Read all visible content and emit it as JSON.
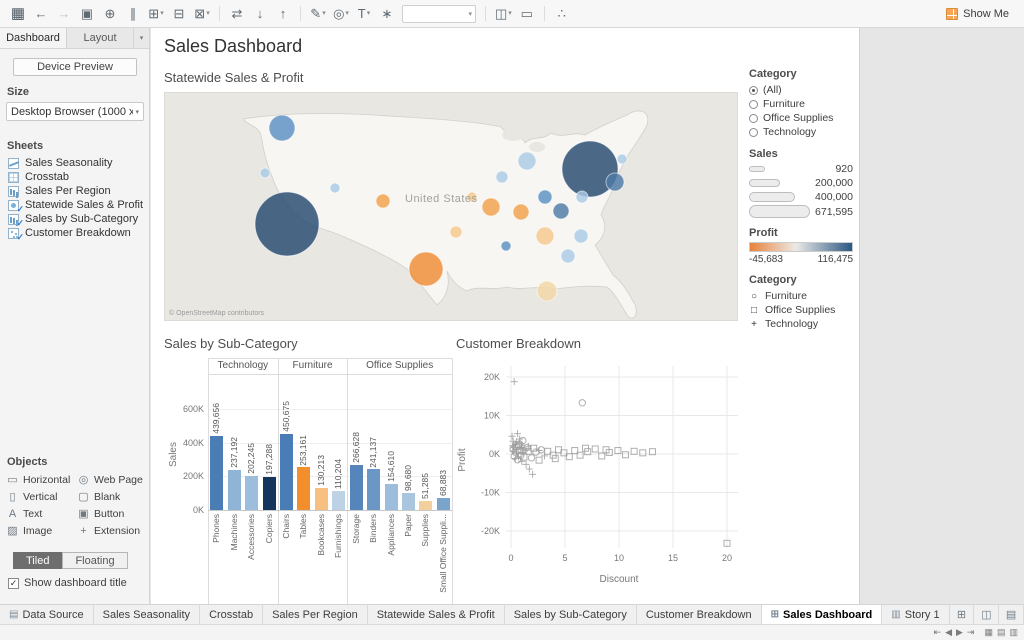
{
  "toolbar": {
    "show_me": "Show Me",
    "items": [
      {
        "name": "tableau-logo-button",
        "glyph": "▦",
        "logo": true
      },
      {
        "name": "undo-button",
        "glyph": "←"
      },
      {
        "name": "redo-button",
        "glyph": "→",
        "disabled": true
      },
      {
        "name": "save-button",
        "glyph": "▣"
      },
      {
        "name": "add-data-button",
        "glyph": "⊕"
      },
      {
        "name": "pause-updates-button",
        "glyph": "∥"
      },
      {
        "name": "new-worksheet-button",
        "glyph": "⊞",
        "caret": true
      },
      {
        "name": "duplicate-button",
        "glyph": "⊟"
      },
      {
        "name": "clear-sheet-button",
        "glyph": "⊠",
        "caret": true
      },
      {
        "sep": true
      },
      {
        "name": "swap-axes-button",
        "glyph": "⇄"
      },
      {
        "name": "sort-ascending-button",
        "glyph": "↓"
      },
      {
        "name": "sort-descending-button",
        "glyph": "↑"
      },
      {
        "sep": true
      },
      {
        "name": "highlight-button",
        "glyph": "✎",
        "caret": true
      },
      {
        "name": "group-members-button",
        "glyph": "◎",
        "caret": true
      },
      {
        "name": "show-mark-labels-button",
        "glyph": "T",
        "caret": true
      },
      {
        "name": "format-button",
        "glyph": "∗"
      },
      {
        "name": "fit-dropdown",
        "select": true,
        "value": ""
      },
      {
        "sep": true
      },
      {
        "name": "show-cards-button",
        "glyph": "◫",
        "caret": true
      },
      {
        "name": "presentation-mode-button",
        "glyph": "▭"
      },
      {
        "sep": true
      },
      {
        "name": "share-button",
        "glyph": "∴"
      }
    ]
  },
  "left_panel": {
    "tabs": [
      {
        "label": "Dashboard",
        "active": true
      },
      {
        "label": "Layout",
        "active": false
      }
    ],
    "device_preview": "Device Preview",
    "size_label": "Size",
    "size_value": "Desktop Browser (1000 x 8...",
    "sheets_label": "Sheets",
    "sheets": [
      {
        "label": "Sales Seasonality",
        "icon": "line-chart",
        "in_dashboard": false
      },
      {
        "label": "Crosstab",
        "icon": "crosstab",
        "in_dashboard": false
      },
      {
        "label": "Sales Per Region",
        "icon": "bar-chart",
        "in_dashboard": false
      },
      {
        "label": "Statewide Sales & Profit",
        "icon": "map",
        "in_dashboard": true
      },
      {
        "label": "Sales by Sub-Category",
        "icon": "bar-chart",
        "in_dashboard": true
      },
      {
        "label": "Customer Breakdown",
        "icon": "scatter",
        "in_dashboard": true
      }
    ],
    "objects_label": "Objects",
    "objects": [
      {
        "label": "Horizontal",
        "icon": "horizontal"
      },
      {
        "label": "Web Page",
        "icon": "web-page"
      },
      {
        "label": "Vertical",
        "icon": "vertical"
      },
      {
        "label": "Blank",
        "icon": "blank"
      },
      {
        "label": "Text",
        "icon": "text"
      },
      {
        "label": "Button",
        "icon": "button"
      },
      {
        "label": "Image",
        "icon": "image"
      },
      {
        "label": "Extension",
        "icon": "extension"
      }
    ],
    "tiled_label": "Tiled",
    "floating_label": "Floating",
    "show_dashboard_title": "Show dashboard title",
    "show_dashboard_title_checked": true
  },
  "dashboard": {
    "title": "Sales Dashboard",
    "map": {
      "title": "Statewide Sales & Profit",
      "country_label": "United States",
      "attribution": "© OpenStreetMap contributors"
    },
    "legends": {
      "category_filter": {
        "title": "Category",
        "options": [
          "(All)",
          "Furniture",
          "Office Supplies",
          "Technology"
        ],
        "selected": "(All)"
      },
      "sales_size": {
        "title": "Sales",
        "values": [
          "920",
          "200,000",
          "400,000",
          "671,595"
        ]
      },
      "profit_gradient": {
        "title": "Profit",
        "min_label": "-45,683",
        "max_label": "116,475",
        "min_color": "#e8823c",
        "mid_color": "#eceae6",
        "max_color": "#2a5783"
      },
      "category_shapes": {
        "title": "Category",
        "items": [
          {
            "shape": "circle",
            "label": "Furniture"
          },
          {
            "shape": "square",
            "label": "Office Supplies"
          },
          {
            "shape": "plus",
            "label": "Technology"
          }
        ]
      }
    },
    "bar_title": "Sales by Sub-Category",
    "scatter_title": "Customer Breakdown"
  },
  "chart_data": [
    {
      "type": "bar",
      "title": "Sales by Sub-Category",
      "ylabel": "Sales",
      "ymax": 600000,
      "yticks": [
        {
          "label": "0K",
          "value": 0
        },
        {
          "label": "200K",
          "value": 200000
        },
        {
          "label": "400K",
          "value": 400000
        },
        {
          "label": "600K",
          "value": 600000
        }
      ],
      "groups": [
        {
          "label": "Technology",
          "bars": [
            {
              "label": "Phones",
              "value": 439656,
              "value_label": "439,656",
              "color": "#4a7db5"
            },
            {
              "label": "Machines",
              "value": 237192,
              "value_label": "237,192",
              "color": "#8fb4d6"
            },
            {
              "label": "Accessories",
              "value": 202245,
              "value_label": "202,245",
              "color": "#9cbddb"
            },
            {
              "label": "Copiers",
              "value": 197288,
              "value_label": "197,288",
              "color": "#16355c"
            }
          ]
        },
        {
          "label": "Furniture",
          "bars": [
            {
              "label": "Chairs",
              "value": 450675,
              "value_label": "450,675",
              "color": "#4a7db5"
            },
            {
              "label": "Tables",
              "value": 253161,
              "value_label": "253,161",
              "color": "#f28e2b"
            },
            {
              "label": "Bookcases",
              "value": 130213,
              "value_label": "130,213",
              "color": "#f8c080"
            },
            {
              "label": "Furnishings",
              "value": 110204,
              "value_label": "110,204",
              "color": "#bed2e6"
            }
          ]
        },
        {
          "label": "Office Supplies",
          "bars": [
            {
              "label": "Storage",
              "value": 266628,
              "value_label": "266,628",
              "color": "#5585ba"
            },
            {
              "label": "Binders",
              "value": 241137,
              "value_label": "241,137",
              "color": "#6b97c6"
            },
            {
              "label": "Appliances",
              "value": 154610,
              "value_label": "154,610",
              "color": "#9cbddb"
            },
            {
              "label": "Paper",
              "value": 98680,
              "value_label": "98,680",
              "color": "#aac6de"
            },
            {
              "label": "Supplies",
              "value": 51285,
              "value_label": "51,285",
              "color": "#f4cf9e"
            },
            {
              "label": "Small Office Suppli...",
              "value": 68883,
              "value_label": "68,883",
              "color": "#7aa4cc"
            }
          ]
        }
      ]
    },
    {
      "type": "scatter",
      "title": "Customer Breakdown",
      "xlabel": "Discount",
      "ylabel": "Profit",
      "xticks": [
        0,
        5,
        10,
        15,
        20
      ],
      "yticks": [
        {
          "label": "20K",
          "value": 20000
        },
        {
          "label": "10K",
          "value": 10000
        },
        {
          "label": "0K",
          "value": 0
        },
        {
          "label": "-10K",
          "value": -10000
        },
        {
          "label": "-20K",
          "value": -20000
        }
      ],
      "xlim": [
        0,
        20
      ],
      "ylim": [
        -25000,
        21000
      ],
      "points": [
        {
          "shape": "plus",
          "x": 0.3,
          "y": 18800
        },
        {
          "shape": "plus",
          "x": 0.1,
          "y": 4600
        },
        {
          "shape": "plus",
          "x": 0.2,
          "y": 3300
        },
        {
          "shape": "plus",
          "x": 0.4,
          "y": 2500
        },
        {
          "shape": "plus",
          "x": 0.6,
          "y": 5300
        },
        {
          "shape": "plus",
          "x": 0.8,
          "y": 3900
        },
        {
          "shape": "plus",
          "x": 1.0,
          "y": 2300
        },
        {
          "shape": "plus",
          "x": 1.2,
          "y": 1100
        },
        {
          "shape": "plus",
          "x": 0.5,
          "y": 500
        },
        {
          "shape": "plus",
          "x": 0.7,
          "y": -700
        },
        {
          "shape": "plus",
          "x": 1.0,
          "y": -1900
        },
        {
          "shape": "plus",
          "x": 1.4,
          "y": -2700
        },
        {
          "shape": "plus",
          "x": 1.7,
          "y": -3900
        },
        {
          "shape": "plus",
          "x": 2.0,
          "y": -5300
        },
        {
          "shape": "plus",
          "x": 0.3,
          "y": 1700
        },
        {
          "shape": "plus",
          "x": 0.2,
          "y": 700
        },
        {
          "shape": "plus",
          "x": 0.9,
          "y": 1500
        },
        {
          "shape": "plus",
          "x": 1.1,
          "y": 300
        },
        {
          "shape": "plus",
          "x": 2.6,
          "y": 900
        },
        {
          "shape": "plus",
          "x": 3.1,
          "y": -500
        },
        {
          "shape": "plus",
          "x": 0.15,
          "y": 2100
        },
        {
          "shape": "plus",
          "x": 0.5,
          "y": 3100
        },
        {
          "shape": "plus",
          "x": 1.6,
          "y": 2000
        },
        {
          "shape": "plus",
          "x": 0.4,
          "y": -1200
        },
        {
          "shape": "circle",
          "x": 6.6,
          "y": 13300
        },
        {
          "shape": "circle",
          "x": 0.2,
          "y": 1300
        },
        {
          "shape": "circle",
          "x": 0.4,
          "y": 500
        },
        {
          "shape": "circle",
          "x": 0.7,
          "y": 2100
        },
        {
          "shape": "circle",
          "x": 0.9,
          "y": -400
        },
        {
          "shape": "circle",
          "x": 1.2,
          "y": 900
        },
        {
          "shape": "circle",
          "x": 1.5,
          "y": 1700
        },
        {
          "shape": "circle",
          "x": 1.9,
          "y": -1000
        },
        {
          "shape": "circle",
          "x": 2.3,
          "y": 500
        },
        {
          "shape": "circle",
          "x": 0.6,
          "y": -1500
        },
        {
          "shape": "circle",
          "x": 1.1,
          "y": 3500
        },
        {
          "shape": "circle",
          "x": 0.3,
          "y": -600
        },
        {
          "shape": "circle",
          "x": 2.8,
          "y": 1100
        },
        {
          "shape": "circle",
          "x": 0.8,
          "y": 2600
        },
        {
          "shape": "square",
          "x": 20,
          "y": -23200
        },
        {
          "shape": "square",
          "x": 3.4,
          "y": 700
        },
        {
          "shape": "square",
          "x": 3.9,
          "y": -300
        },
        {
          "shape": "square",
          "x": 4.4,
          "y": 1100
        },
        {
          "shape": "square",
          "x": 4.9,
          "y": 300
        },
        {
          "shape": "square",
          "x": 5.4,
          "y": -700
        },
        {
          "shape": "square",
          "x": 5.9,
          "y": 900
        },
        {
          "shape": "square",
          "x": 6.4,
          "y": -300
        },
        {
          "shape": "square",
          "x": 7.1,
          "y": 600
        },
        {
          "shape": "square",
          "x": 7.8,
          "y": 1300
        },
        {
          "shape": "square",
          "x": 8.4,
          "y": -500
        },
        {
          "shape": "square",
          "x": 9.1,
          "y": 400
        },
        {
          "shape": "square",
          "x": 9.9,
          "y": 900
        },
        {
          "shape": "square",
          "x": 10.6,
          "y": -200
        },
        {
          "shape": "square",
          "x": 11.4,
          "y": 700
        },
        {
          "shape": "square",
          "x": 12.2,
          "y": 300
        },
        {
          "shape": "square",
          "x": 13.1,
          "y": 600
        },
        {
          "shape": "square",
          "x": 2.1,
          "y": 1500
        },
        {
          "shape": "square",
          "x": 1.6,
          "y": 700
        },
        {
          "shape": "square",
          "x": 1.2,
          "y": -800
        },
        {
          "shape": "square",
          "x": 0.8,
          "y": 900
        },
        {
          "shape": "square",
          "x": 0.5,
          "y": 1900
        },
        {
          "shape": "square",
          "x": 4.1,
          "y": -1200
        },
        {
          "shape": "square",
          "x": 6.9,
          "y": 1500
        },
        {
          "shape": "square",
          "x": 8.8,
          "y": 1100
        },
        {
          "shape": "square",
          "x": 2.6,
          "y": -1600
        }
      ]
    },
    {
      "type": "map-bubbles",
      "title": "Statewide Sales & Profit",
      "bubbles": [
        {
          "x": 117,
          "y": 35,
          "r": 13,
          "color": "#5a8fc2"
        },
        {
          "x": 100,
          "y": 80,
          "r": 5,
          "color": "#a9c9e4"
        },
        {
          "x": 122,
          "y": 131,
          "r": 32,
          "color": "#24486f"
        },
        {
          "x": 170,
          "y": 95,
          "r": 5,
          "color": "#a9c9e4"
        },
        {
          "x": 218,
          "y": 108,
          "r": 7,
          "color": "#f0a04b"
        },
        {
          "x": 261,
          "y": 176,
          "r": 17,
          "color": "#ef8b33"
        },
        {
          "x": 425,
          "y": 76,
          "r": 28,
          "color": "#24486f"
        },
        {
          "x": 450,
          "y": 89,
          "r": 9,
          "color": "#4e79a7"
        },
        {
          "x": 457,
          "y": 66,
          "r": 5,
          "color": "#a9c9e4"
        },
        {
          "x": 362,
          "y": 68,
          "r": 9,
          "color": "#a9c9e4"
        },
        {
          "x": 337,
          "y": 84,
          "r": 6,
          "color": "#a9c9e4"
        },
        {
          "x": 326,
          "y": 114,
          "r": 9,
          "color": "#f0a04b"
        },
        {
          "x": 307,
          "y": 104,
          "r": 5,
          "color": "#f6c78e"
        },
        {
          "x": 356,
          "y": 119,
          "r": 8,
          "color": "#f0a04b"
        },
        {
          "x": 396,
          "y": 118,
          "r": 8,
          "color": "#4e79a7"
        },
        {
          "x": 380,
          "y": 104,
          "r": 7,
          "color": "#5a8fc2"
        },
        {
          "x": 417,
          "y": 104,
          "r": 6,
          "color": "#a9c9e4"
        },
        {
          "x": 380,
          "y": 143,
          "r": 9,
          "color": "#f6c78e"
        },
        {
          "x": 416,
          "y": 143,
          "r": 7,
          "color": "#a9c9e4"
        },
        {
          "x": 403,
          "y": 163,
          "r": 7,
          "color": "#a9c9e4"
        },
        {
          "x": 291,
          "y": 139,
          "r": 6,
          "color": "#f6c78e"
        },
        {
          "x": 341,
          "y": 153,
          "r": 5,
          "color": "#5a8fc2"
        },
        {
          "x": 382,
          "y": 198,
          "r": 10,
          "color": "#f3d7a6"
        }
      ]
    }
  ],
  "sheet_tabs": [
    {
      "label": "Data Source",
      "icon": "data-source"
    },
    {
      "label": "Sales Seasonality"
    },
    {
      "label": "Crosstab"
    },
    {
      "label": "Sales Per Region"
    },
    {
      "label": "Statewide Sales & Profit"
    },
    {
      "label": "Sales by Sub-Category"
    },
    {
      "label": "Customer Breakdown"
    },
    {
      "label": "Sales Dashboard",
      "icon": "dashboard",
      "active": true
    },
    {
      "label": "Story 1",
      "icon": "story"
    }
  ],
  "new_tab_buttons": [
    {
      "name": "new-worksheet-tab-button",
      "glyph": "⊞"
    },
    {
      "name": "new-dashboard-tab-button",
      "glyph": "◫"
    },
    {
      "name": "new-story-tab-button",
      "glyph": "▤"
    }
  ],
  "status_bar": {
    "nav_icons": [
      {
        "name": "first-sheet-button",
        "glyph": "⇤"
      },
      {
        "name": "previous-sheet-button",
        "glyph": "◀"
      },
      {
        "name": "next-sheet-button",
        "glyph": "▶"
      },
      {
        "name": "last-sheet-button",
        "glyph": "⇥"
      }
    ],
    "view_icons": [
      {
        "name": "show-tabs-button",
        "glyph": "▦"
      },
      {
        "name": "show-filmstrip-button",
        "glyph": "▤"
      },
      {
        "name": "show-sheet-sorter-button",
        "glyph": "▥"
      }
    ]
  }
}
